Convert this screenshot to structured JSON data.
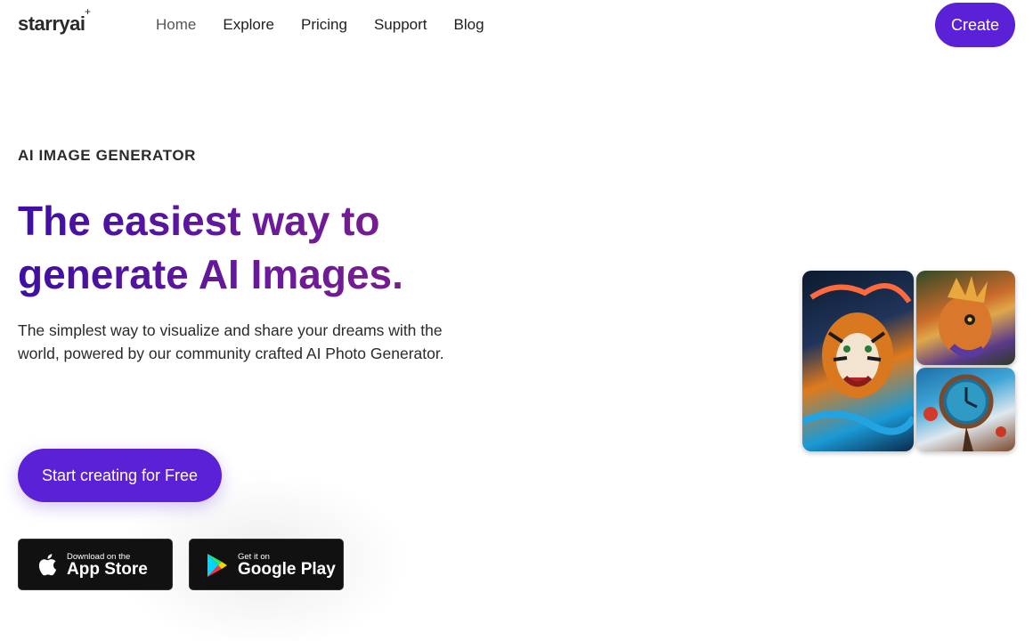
{
  "header": {
    "logo": "starryai",
    "logo_spark": "+",
    "nav": [
      {
        "label": "Home"
      },
      {
        "label": "Explore"
      },
      {
        "label": "Pricing"
      },
      {
        "label": "Support"
      },
      {
        "label": "Blog"
      }
    ],
    "create_label": "Create"
  },
  "hero": {
    "eyebrow": "AI IMAGE GENERATOR",
    "headline_line1": "The easiest way to",
    "headline_line2": "generate AI Images.",
    "subtext": "The simplest way to visualize and share your dreams with the world, powered by our community crafted AI Photo Generator.",
    "cta_label": "Start creating for Free"
  },
  "stores": {
    "apple": {
      "small": "Download on the",
      "big": "App Store",
      "icon": "apple-icon"
    },
    "google": {
      "small": "Get it on",
      "big": "Google Play",
      "icon": "google-play-icon"
    }
  },
  "gallery": {
    "images": [
      "tiger-artwork",
      "bird-artwork",
      "clock-artwork"
    ]
  },
  "colors": {
    "accent": "#5b21d6",
    "headline_start": "#3d0fa3",
    "headline_end": "#7c1e86"
  }
}
